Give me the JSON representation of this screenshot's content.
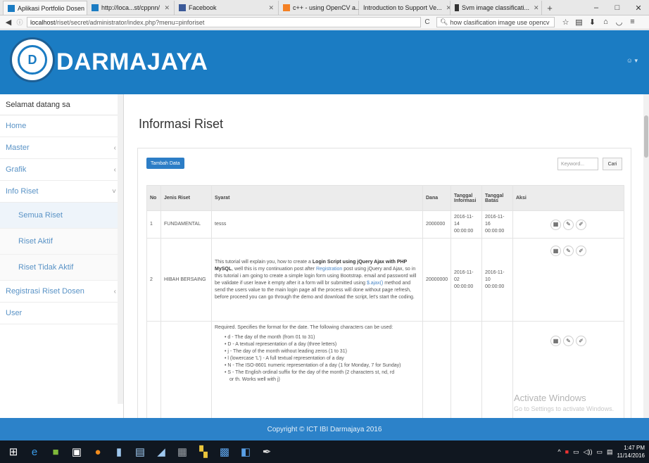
{
  "browser": {
    "tabs": [
      {
        "label": "Aplikasi Portfolio Dosen",
        "color": "#1b7cc3",
        "icon": "site-icon"
      },
      {
        "label": "http://loca...st/cppnn/",
        "color": "#1b7cc3",
        "icon": "site-icon"
      },
      {
        "label": "Facebook",
        "color": "#3b5998",
        "icon": "facebook-icon"
      },
      {
        "label": "c++ - using OpenCV a...",
        "color": "#f48024",
        "icon": "stackoverflow-icon"
      },
      {
        "label": "Introduction to Support Ve...",
        "color": "#888888",
        "icon": "page-icon"
      },
      {
        "label": "Svm image classificati...",
        "color": "#333333",
        "icon": "pen-icon"
      }
    ],
    "url_host": "localhost",
    "url_path": "/riset/secret/administrator/index.php?menu=pinforiset",
    "search_text": "how clasification image use opencv"
  },
  "header": {
    "brand": "DARMAJAYA",
    "logo_glyph": "D",
    "user_label": "☺ ▾",
    "bg_color": "#1b7cc3"
  },
  "sidebar": {
    "welcome": "Selamat datang sa",
    "items": [
      {
        "label": "Home"
      },
      {
        "label": "Master",
        "chevron": "‹"
      },
      {
        "label": "Grafik",
        "chevron": "‹"
      },
      {
        "label": "Info Riset",
        "chevron": "˅"
      }
    ],
    "subitems": [
      {
        "label": "Semua Riset"
      },
      {
        "label": "Riset Aktif"
      },
      {
        "label": "Riset Tidak Aktif"
      }
    ],
    "items2": [
      {
        "label": "Registrasi Riset Dosen",
        "chevron": "‹"
      },
      {
        "label": "User"
      }
    ]
  },
  "main": {
    "title": "Informasi Riset",
    "add_button": "Tambah Data",
    "keyword_placeholder": "Keyword...",
    "search_button": "Cari",
    "columns": [
      "No",
      "Jenis Riset",
      "Syarat",
      "Dana",
      "Tanggal Informasi",
      "Tanggal Batas",
      "Aksi"
    ],
    "rows": [
      {
        "no": "1",
        "jenis": "FUNDAMENTAL",
        "syarat": "tesss",
        "dana": "2000000",
        "tgl_info": "2016-11-14 00:00:00",
        "tgl_batas": "2016-11-16 00:00:00"
      },
      {
        "no": "2",
        "jenis": "HIBAH BERSAING",
        "syarat_a": "This tutorial will explain you, how to create a ",
        "syarat_b": "Login Script using jQuery Ajax with PHP MySQL",
        "syarat_c": ", well this is my continuation post after ",
        "syarat_link": "Registration",
        "syarat_d": " post using jQuery and Ajax, so in this tutorial i am going to create a simple login form using Bootstrap. email and password will be validate if user leave it empty after it a form will br submitted using ",
        "syarat_link2": "$.ajax()",
        "syarat_e": " method and send the users value to the main login page all the process will done without page refresh, before proceed you can go through the demo and download the script, let's start the coding.",
        "dana": "20000000",
        "tgl_info": "2016-11-02 00:00:00",
        "tgl_batas": "2016-11-10 00:00:00"
      },
      {
        "no": "",
        "jenis": "",
        "syarat_intro": "Required. Specifies the format for the date. The following characters can be used:",
        "list": [
          "d - The day of the month (from 01 to 31)",
          "D - A textual representation of a day (three letters)",
          "j - The day of the month without leading zeros (1 to 31)",
          "l (lowercase 'L') - A full textual representation of a day",
          "N - The ISO-8601 numeric representation of a day (1 for Monday, 7 for Sunday)",
          "S - The English ordinal suffix for the day of the month (2 characters st, nd, rd",
          "or th. Works well with j)"
        ],
        "dana": "",
        "tgl_info": "",
        "tgl_batas": ""
      }
    ]
  },
  "overlay": {
    "watermark_title": "Activate Windows",
    "watermark_sub": "Go to Settings to activate Windows."
  },
  "footer": {
    "copyright": "Copyright © ICT IBI Darmajaya 2016"
  },
  "taskbar": {
    "time": "1:47 PM",
    "date": "11/14/2016"
  }
}
